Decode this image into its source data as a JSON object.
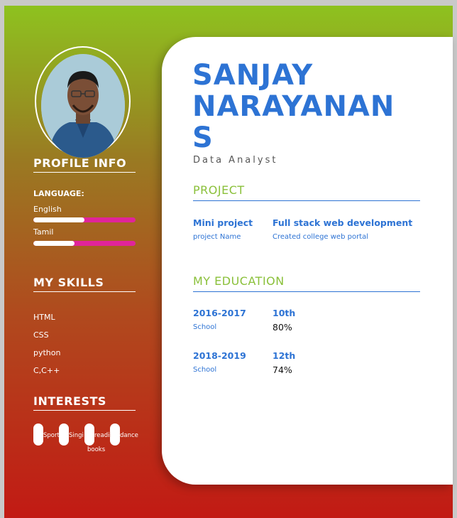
{
  "sidebar": {
    "profile_heading": "PROFILE INFO",
    "language_title": "LANGUAGE:",
    "languages": [
      {
        "name": "English",
        "level": 0.5
      },
      {
        "name": "Tamil",
        "level": 0.4
      }
    ],
    "skills_heading": "MY SKILLS",
    "skills": [
      "HTML",
      "CSS",
      "python",
      "C,C++"
    ],
    "interests_heading": "INTERESTS",
    "interests": [
      "Sports",
      "Singing",
      "reading books",
      "dance"
    ],
    "interest_labels": {
      "a": "Sport",
      "b": "Singi",
      "c": "readi",
      "d": "dance",
      "e": "books"
    }
  },
  "header": {
    "name_line1": "SANJAY",
    "name_line2": "NARAYANAN",
    "name_line3": "S",
    "role": "Data Analyst"
  },
  "project": {
    "heading": "PROJECT",
    "items": [
      {
        "title": "Mini project",
        "subtitle": "project Name"
      },
      {
        "title": "Full stack web development",
        "subtitle": "Created college web portal"
      }
    ]
  },
  "education": {
    "heading": "MY EDUCATION",
    "items": [
      {
        "years": "2016-2017",
        "type": "School",
        "grade": "10th",
        "score": "80%"
      },
      {
        "years": "2018-2019",
        "type": "School",
        "grade": "12th",
        "score": "74%"
      }
    ]
  },
  "colors": {
    "accent_blue": "#2d73d4",
    "accent_green": "#8ac03a",
    "bar_pink": "#e0249a"
  }
}
